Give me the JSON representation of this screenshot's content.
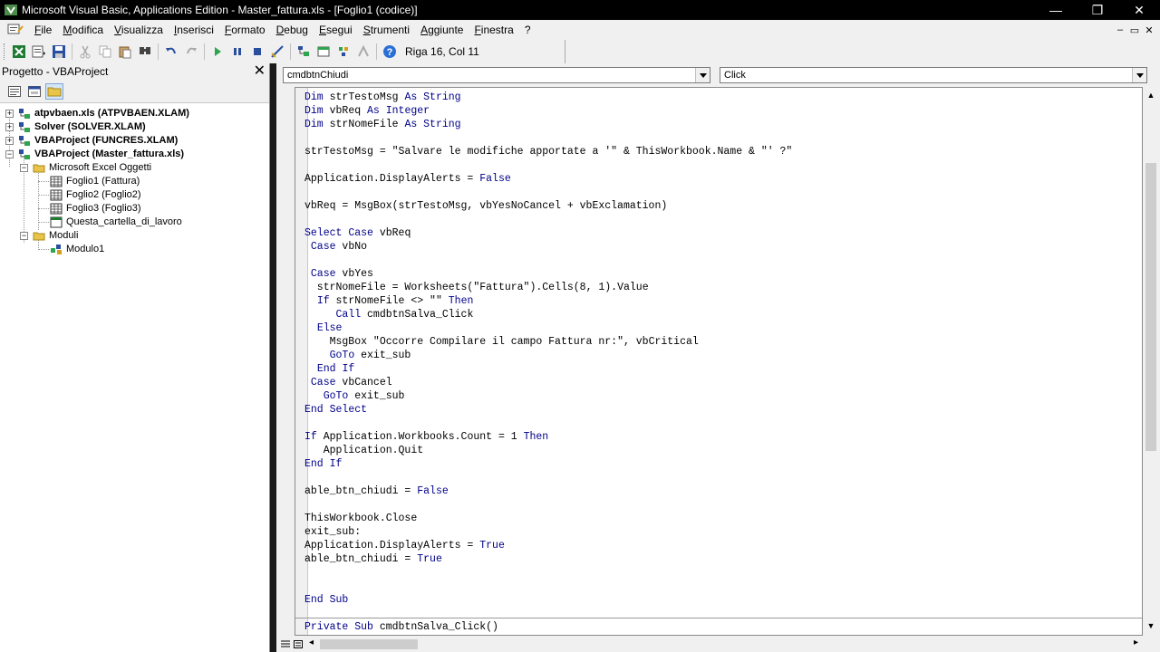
{
  "window": {
    "title": "Microsoft Visual Basic, Applications Edition - Master_fattura.xls - [Foglio1 (codice)]",
    "controls": [
      "—",
      "❐",
      "✕"
    ]
  },
  "menubar": {
    "items": [
      "File",
      "Modifica",
      "Visualizza",
      "Inserisci",
      "Formato",
      "Debug",
      "Esegui",
      "Strumenti",
      "Aggiunte",
      "Finestra",
      "?"
    ],
    "doc_controls": [
      "–",
      "▭",
      "✕"
    ]
  },
  "toolbar": {
    "icons": [
      "view-excel-icon",
      "insert-module-icon",
      "save-icon",
      "cut-icon",
      "copy-icon",
      "paste-icon",
      "find-icon",
      "undo-icon",
      "redo-icon",
      "run-icon",
      "pause-icon",
      "reset-icon",
      "design-mode-icon",
      "project-explorer-icon",
      "properties-icon",
      "object-browser-icon",
      "toolbox-icon",
      "help-icon"
    ],
    "status": "Riga 16, Col 11"
  },
  "project": {
    "title": "Progetto - VBAProject",
    "close": "✕",
    "nodes": [
      {
        "label": "atpvbaen.xls (ATPVBAEN.XLAM)",
        "bold": true
      },
      {
        "label": "Solver (SOLVER.XLAM)",
        "bold": true
      },
      {
        "label": "VBAProject (FUNCRES.XLAM)",
        "bold": true
      },
      {
        "label": "VBAProject (Master_fattura.xls)",
        "bold": true
      },
      {
        "label": "Microsoft Excel Oggetti",
        "bold": false
      },
      {
        "label": "Foglio1 (Fattura)",
        "bold": false
      },
      {
        "label": "Foglio2 (Foglio2)",
        "bold": false
      },
      {
        "label": "Foglio3 (Foglio3)",
        "bold": false
      },
      {
        "label": "Questa_cartella_di_lavoro",
        "bold": false
      },
      {
        "label": "Moduli",
        "bold": false
      },
      {
        "label": "Modulo1",
        "bold": false
      }
    ],
    "expanders": [
      "+",
      "+",
      "+",
      "−",
      "−",
      "−"
    ]
  },
  "code": {
    "object_combo": "cmdbtnChiudi",
    "proc_combo": "Click",
    "lines": [
      "Dim strTestoMsg As String",
      "Dim vbReq As Integer",
      "Dim strNomeFile As String",
      "",
      "strTestoMsg = \"Salvare le modifiche apportate a '\" & ThisWorkbook.Name & \"' ?\"",
      "",
      "Application.DisplayAlerts = False",
      "",
      "vbReq = MsgBox(strTestoMsg, vbYesNoCancel + vbExclamation)",
      "",
      "Select Case vbReq",
      " Case vbNo",
      "",
      " Case vbYes",
      "  strNomeFile = Worksheets(\"Fattura\").Cells(8, 1).Value",
      "  If strNomeFile <> \"\" Then",
      "     Call cmdbtnSalva_Click",
      "  Else",
      "    MsgBox \"Occorre Compilare il campo Fattura nr:\", vbCritical",
      "    GoTo exit_sub",
      "  End If",
      " Case vbCancel",
      "   GoTo exit_sub",
      "End Select",
      "",
      "If Application.Workbooks.Count = 1 Then",
      "   Application.Quit",
      "End If",
      "",
      "able_btn_chiudi = False",
      "",
      "ThisWorkbook.Close",
      "exit_sub:",
      "Application.DisplayAlerts = True",
      "able_btn_chiudi = True",
      "",
      "",
      "End Sub",
      "",
      "Private Sub cmdbtnSalva_Click()"
    ]
  },
  "colors": {
    "keyword": "#00008b",
    "titlebar": "#000000",
    "chrome": "#f0f0f0"
  }
}
